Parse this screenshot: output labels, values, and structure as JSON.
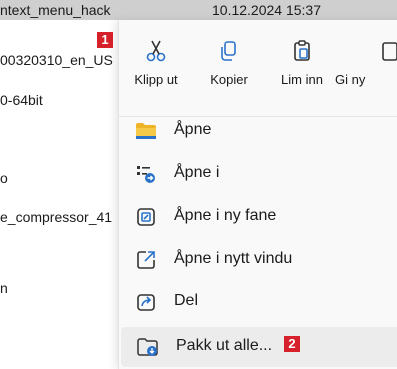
{
  "explorer": {
    "header_name": "ntext_menu_hack",
    "header_date": "10.12.2024 15:37",
    "rows": [
      "00320310_en_US",
      "0-64bit",
      "o",
      "e_compressor_41",
      "n"
    ]
  },
  "badges": {
    "first": "1",
    "second": "2"
  },
  "quick_actions": [
    {
      "label": "Klipp ut",
      "icon": "scissors-icon"
    },
    {
      "label": "Kopier",
      "icon": "copy-icon"
    },
    {
      "label": "Lim inn",
      "icon": "paste-icon"
    },
    {
      "label": "Gi ny",
      "icon": "rename-icon"
    }
  ],
  "menu_items": [
    {
      "label": "Åpne",
      "icon": "folder-icon"
    },
    {
      "label": "Åpne i",
      "icon": "open-with-icon"
    },
    {
      "label": "Åpne i ny fane",
      "icon": "new-tab-icon"
    },
    {
      "label": "Åpne i nytt vindu",
      "icon": "new-window-icon"
    },
    {
      "label": "Del",
      "icon": "share-icon"
    },
    {
      "label": "Pakk ut alle...",
      "icon": "extract-icon"
    }
  ],
  "colors": {
    "badge": "#d6202a",
    "accent": "#2a72c9",
    "folder": "#f0b429"
  }
}
